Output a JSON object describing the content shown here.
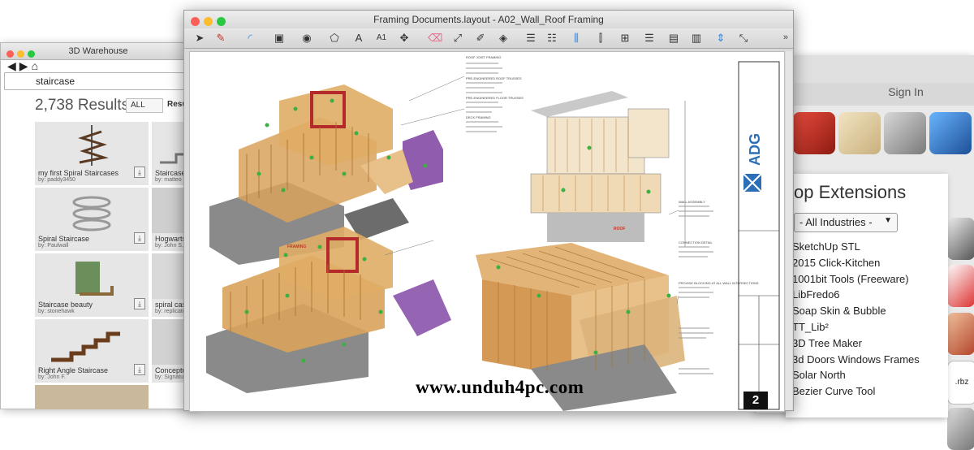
{
  "colors": {
    "wood": "#d9a25a",
    "wood_dark": "#b07a38",
    "concrete": "#8a8a8a",
    "red_framing": "#b42a2a",
    "purple_framing": "#7b3fa0",
    "green_marker": "#3cb043",
    "mac_close": "#fc5f57",
    "mac_min": "#fdbc2e",
    "mac_max": "#28c840"
  },
  "warehouse_window": {
    "title": "3D Warehouse",
    "search_value": "staircase",
    "results_count": "2,738 Results",
    "filter_value": "ALL",
    "results_label": "Resul",
    "cards": [
      {
        "name": "my first Spiral Staircases",
        "by": "by: paddy3450",
        "icon": "spiral-staircase-thumb"
      },
      {
        "name": "Staircase",
        "by": "by: matteo S",
        "icon": "staircase-thumb"
      },
      {
        "name": "Spiral Staircase",
        "by": "by: Paulwall",
        "icon": "spiral-staircase-thumb"
      },
      {
        "name": "Hogwarts G",
        "by": "by: John S.",
        "icon": "staircase-thumb"
      },
      {
        "name": "Staircase beauty",
        "by": "by: stonehawk",
        "icon": "staircase-thumb"
      },
      {
        "name": "spiral castle",
        "by": "by: replicator",
        "icon": "spiral-staircase-thumb"
      },
      {
        "name": "Right Angle Staircase",
        "by": "by: John F.",
        "icon": "staircase-thumb"
      },
      {
        "name": "Conceptua",
        "by": "by: Signature",
        "icon": "staircase-thumb"
      }
    ]
  },
  "layout_window": {
    "title": "Framing Documents.layout - A02_Wall_Roof Framing",
    "toolbar_more": "»",
    "page_number": "2",
    "company_name": "ADG",
    "floor_labels": [
      "FRAMING",
      "ROOF"
    ],
    "watermark": "www.unduh4pc.com",
    "notes": [
      "ROOF JOIST FRAMING",
      "PRE-ENGINEERED ROOF TRUSSES",
      "PRE-ENGINEERED FLOOR TRUSSES",
      "DECK FRAMING",
      "WALL ASSEMBLY",
      "CONNECTION DETAIL",
      "PROVIDE BLOCKING AT ALL WALL INTERSECTIONS"
    ]
  },
  "extension_window": {
    "sign_in": "Sign In",
    "panel_title": "op Extensions",
    "industry_filter": "- All Industries -",
    "extensions": [
      "SketchUp STL",
      "2015 Click-Kitchen",
      "1001bit Tools (Freeware)",
      "LibFredo6",
      "Soap Skin & Bubble",
      "TT_Lib²",
      "3D Tree Maker",
      "3d Doors Windows Frames",
      "Solar North",
      "Bezier Curve Tool"
    ],
    "tile_label": ".rbz"
  }
}
